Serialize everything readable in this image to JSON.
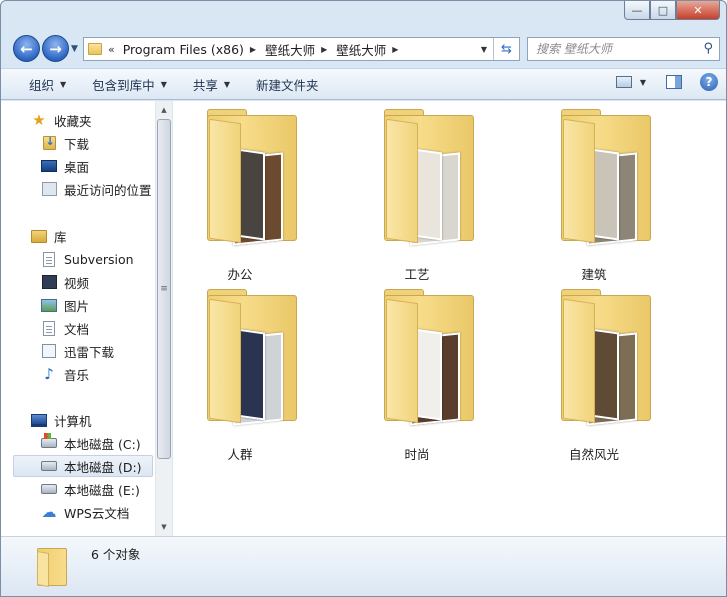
{
  "window": {
    "caption_buttons": {
      "minimize": "—",
      "maximize": "□",
      "close": "✕"
    }
  },
  "address_bar": {
    "overflow_chevron": "«",
    "breadcrumbs": [
      "Program Files (x86)",
      "壁纸大师",
      "壁纸大师"
    ],
    "separator": "▶"
  },
  "search": {
    "placeholder": "搜索 壁纸大师"
  },
  "toolbar": {
    "organize": "组织",
    "include_in_library": "包含到库中",
    "share": "共享",
    "new_folder": "新建文件夹"
  },
  "navigation": {
    "favorites": {
      "label": "收藏夹",
      "items": [
        "下载",
        "桌面",
        "最近访问的位置"
      ]
    },
    "libraries": {
      "label": "库",
      "items": [
        "Subversion",
        "视频",
        "图片",
        "文档",
        "迅雷下载",
        "音乐"
      ]
    },
    "computer": {
      "label": "计算机",
      "items": [
        "本地磁盘 (C:)",
        "本地磁盘 (D:)",
        "本地磁盘 (E:)",
        "WPS云文档"
      ],
      "selected": "本地磁盘 (D:)"
    }
  },
  "folders": [
    {
      "name": "办公",
      "photo_colors": [
        "#4a4440",
        "#6b4a2f"
      ]
    },
    {
      "name": "工艺",
      "photo_colors": [
        "#e9e4dc",
        "#d9d5cf"
      ]
    },
    {
      "name": "建筑",
      "photo_colors": [
        "#c9c3b8",
        "#8c8578"
      ]
    },
    {
      "name": "人群",
      "photo_colors": [
        "#2a3450",
        "#cfd3d8"
      ]
    },
    {
      "name": "时尚",
      "photo_colors": [
        "#f1efec",
        "#5a3d2c"
      ]
    },
    {
      "name": "自然风光",
      "photo_colors": [
        "#5e4a35",
        "#7c6e54"
      ]
    }
  ],
  "status": {
    "count_text": "6 个对象"
  }
}
